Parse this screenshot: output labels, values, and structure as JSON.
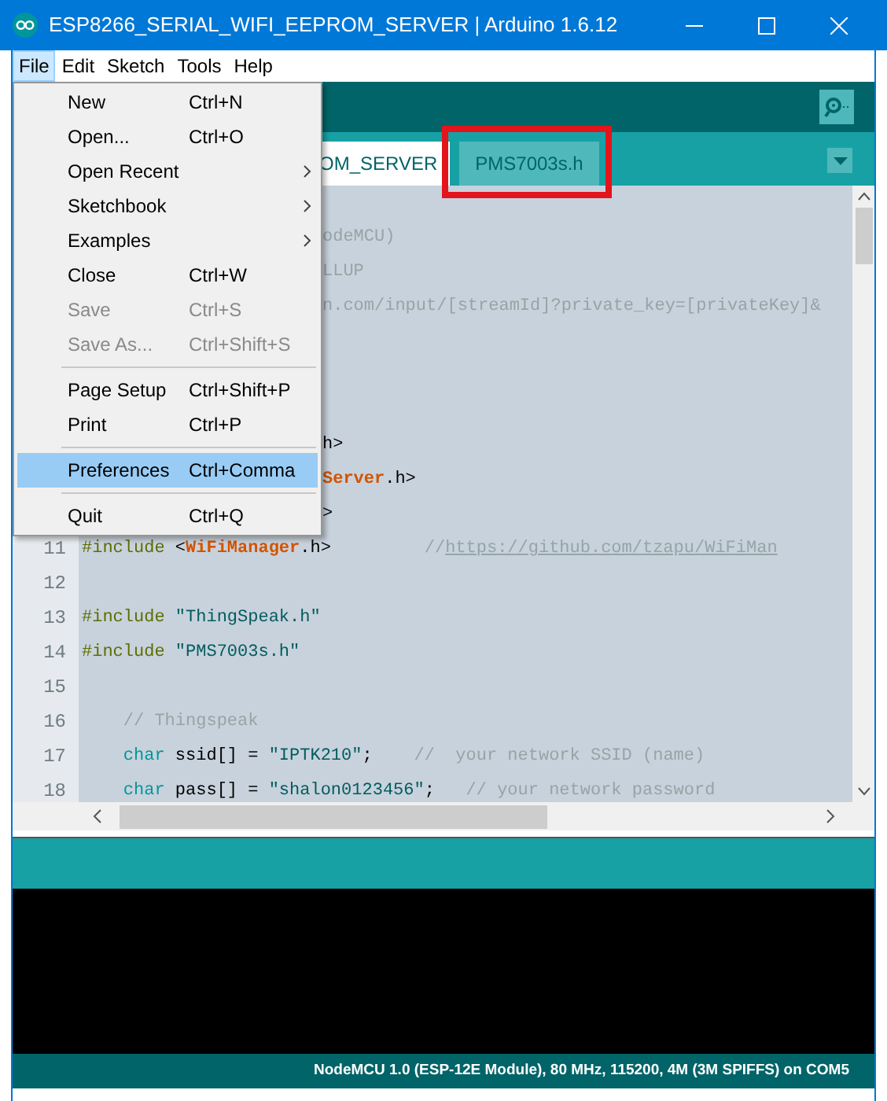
{
  "window": {
    "title": "ESP8266_SERIAL_WIFI_EEPROM_SERVER | Arduino 1.6.12"
  },
  "menu_bar": [
    {
      "label": "File",
      "selected": true
    },
    {
      "label": "Edit",
      "selected": false
    },
    {
      "label": "Sketch",
      "selected": false
    },
    {
      "label": "Tools",
      "selected": false
    },
    {
      "label": "Help",
      "selected": false
    }
  ],
  "file_menu": [
    {
      "kind": "item",
      "label": "New",
      "shortcut": "Ctrl+N",
      "disabled": false,
      "selected": false
    },
    {
      "kind": "item",
      "label": "Open...",
      "shortcut": "Ctrl+O",
      "disabled": false,
      "selected": false
    },
    {
      "kind": "submenu",
      "label": "Open Recent",
      "disabled": false,
      "selected": false
    },
    {
      "kind": "submenu",
      "label": "Sketchbook",
      "disabled": false,
      "selected": false
    },
    {
      "kind": "submenu",
      "label": "Examples",
      "disabled": false,
      "selected": false
    },
    {
      "kind": "item",
      "label": "Close",
      "shortcut": "Ctrl+W",
      "disabled": false,
      "selected": false
    },
    {
      "kind": "item",
      "label": "Save",
      "shortcut": "Ctrl+S",
      "disabled": true,
      "selected": false
    },
    {
      "kind": "item",
      "label": "Save As...",
      "shortcut": "Ctrl+Shift+S",
      "disabled": true,
      "selected": false
    },
    {
      "kind": "separator"
    },
    {
      "kind": "item",
      "label": "Page Setup",
      "shortcut": "Ctrl+Shift+P",
      "disabled": false,
      "selected": false
    },
    {
      "kind": "item",
      "label": "Print",
      "shortcut": "Ctrl+P",
      "disabled": false,
      "selected": false
    },
    {
      "kind": "separator"
    },
    {
      "kind": "item",
      "label": "Preferences",
      "shortcut": "Ctrl+Comma",
      "disabled": false,
      "selected": true
    },
    {
      "kind": "separator"
    },
    {
      "kind": "item",
      "label": "Quit",
      "shortcut": "Ctrl+Q",
      "disabled": false,
      "selected": false
    }
  ],
  "tabs": [
    {
      "label": "OM_SERVER",
      "selected": true
    },
    {
      "label": "PMS7003s.h",
      "selected": false
    }
  ],
  "editor": {
    "lines": [
      {
        "kind": "blank"
      },
      {
        "cut": true,
        "tokens": [
          {
            "kind": "comment",
            "text": "odeMCU)"
          }
        ]
      },
      {
        "cut": true,
        "tokens": [
          {
            "kind": "comment",
            "text": "LLUP"
          }
        ]
      },
      {
        "cut": true,
        "tokens": [
          {
            "kind": "comment",
            "text": "n.com/input/[streamId]?private_key=[privateKey]&"
          }
        ]
      },
      {
        "kind": "blank"
      },
      {
        "kind": "blank"
      },
      {
        "kind": "blank"
      },
      {
        "cut": true,
        "tokens": [
          {
            "kind": "plain",
            "text": "h>"
          }
        ]
      },
      {
        "cut": true,
        "tokens": [
          {
            "kind": "library",
            "text": "Server"
          },
          {
            "kind": "plain",
            "text": ".h>"
          }
        ]
      },
      {
        "cut": true,
        "tokens": [
          {
            "kind": "plain",
            "text": ">"
          }
        ]
      },
      {
        "number": "11",
        "tokens": [
          {
            "kind": "keyword",
            "text": "#include"
          },
          {
            "kind": "plain",
            "text": " <"
          },
          {
            "kind": "library",
            "text": "WiFiManager"
          },
          {
            "kind": "plain",
            "text": ".h>         "
          },
          {
            "kind": "comment",
            "text": "//"
          },
          {
            "kind": "link",
            "text": "https://github.com/tzapu/WiFiMan"
          }
        ]
      },
      {
        "number": "12"
      },
      {
        "number": "13",
        "tokens": [
          {
            "kind": "keyword",
            "text": "#include "
          },
          {
            "kind": "string",
            "text": "\"ThingSpeak.h\""
          }
        ]
      },
      {
        "number": "14",
        "tokens": [
          {
            "kind": "keyword",
            "text": "#include "
          },
          {
            "kind": "string",
            "text": "\"PMS7003s.h\""
          }
        ]
      },
      {
        "number": "15"
      },
      {
        "number": "16",
        "tokens": [
          {
            "kind": "comment",
            "text": "    // Thingspeak"
          }
        ]
      },
      {
        "number": "17",
        "tokens": [
          {
            "kind": "type",
            "text": "    char"
          },
          {
            "kind": "plain",
            "text": " ssid[] = "
          },
          {
            "kind": "string",
            "text": "\"IPTK210\""
          },
          {
            "kind": "plain",
            "text": ";    "
          },
          {
            "kind": "comment",
            "text": "//  your network SSID (name)"
          }
        ]
      },
      {
        "number": "18",
        "tokens": [
          {
            "kind": "type",
            "text": "    char"
          },
          {
            "kind": "plain",
            "text": " pass[] = "
          },
          {
            "kind": "string",
            "text": "\"shalon0123456\""
          },
          {
            "kind": "plain",
            "text": ";   "
          },
          {
            "kind": "comment",
            "text": "// your network password"
          }
        ]
      }
    ]
  },
  "status_bar": {
    "text": "NodeMCU 1.0 (ESP-12E Module), 80 MHz, 115200, 4M (3M SPIFFS) on COM5"
  }
}
